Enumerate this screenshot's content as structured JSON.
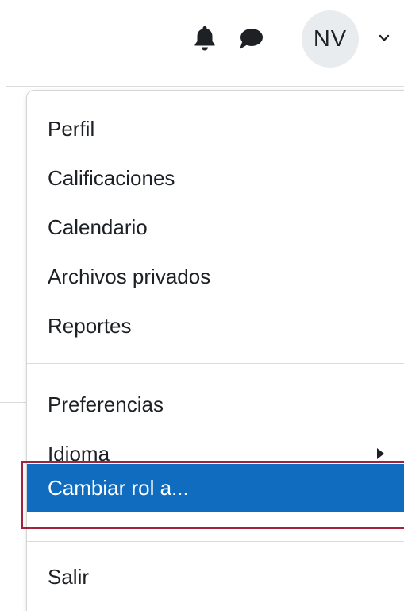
{
  "header": {
    "icons": [
      "bell-icon",
      "chat-bubble-icon"
    ],
    "avatar_initials": "NV",
    "user_menu_toggle_icon": "chevron-down-icon"
  },
  "user_menu": {
    "items": [
      {
        "label": "Perfil"
      },
      {
        "label": "Calificaciones"
      },
      {
        "label": "Calendario"
      },
      {
        "label": "Archivos privados"
      },
      {
        "label": "Reportes"
      },
      {
        "label": "Preferencias"
      },
      {
        "label": "Idioma",
        "has_submenu": true
      },
      {
        "label": "Cambiar rol a...",
        "active": true
      },
      {
        "label": "Salir"
      }
    ]
  },
  "colors": {
    "active_background": "#0f6cbf",
    "highlight_border": "#a3233c",
    "text": "#1d2125",
    "avatar_background": "#e9ecef"
  }
}
